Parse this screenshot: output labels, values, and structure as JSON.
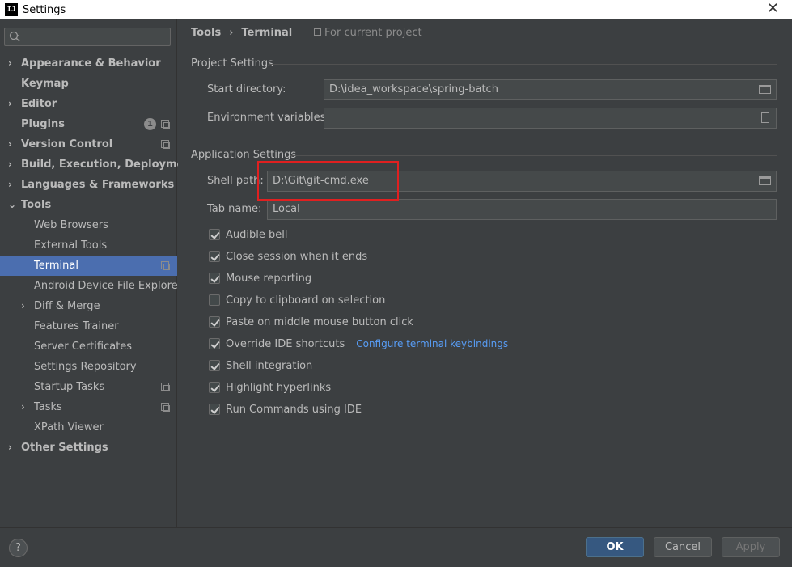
{
  "window": {
    "title": "Settings",
    "app_icon": "IJ"
  },
  "sidebar": {
    "search": {
      "value": "",
      "placeholder": ""
    },
    "items": [
      {
        "label": "Appearance & Behavior",
        "bold": true,
        "arrow": "›",
        "level": 0
      },
      {
        "label": "Keymap",
        "bold": true,
        "arrow": "",
        "level": 0
      },
      {
        "label": "Editor",
        "bold": true,
        "arrow": "›",
        "level": 0
      },
      {
        "label": "Plugins",
        "bold": true,
        "arrow": "",
        "level": 0,
        "badge": "1",
        "project_icon": true
      },
      {
        "label": "Version Control",
        "bold": true,
        "arrow": "›",
        "level": 0,
        "project_icon": true
      },
      {
        "label": "Build, Execution, Deployment",
        "bold": true,
        "arrow": "›",
        "level": 0
      },
      {
        "label": "Languages & Frameworks",
        "bold": true,
        "arrow": "›",
        "level": 0
      },
      {
        "label": "Tools",
        "bold": true,
        "arrow": "⌄",
        "level": 0
      },
      {
        "label": "Web Browsers",
        "level": 1
      },
      {
        "label": "External Tools",
        "level": 1
      },
      {
        "label": "Terminal",
        "level": 1,
        "selected": true,
        "project_icon": true
      },
      {
        "label": "Android Device File Explorer",
        "level": 1
      },
      {
        "label": "Diff & Merge",
        "level": 1,
        "arrow": "›"
      },
      {
        "label": "Features Trainer",
        "level": 1
      },
      {
        "label": "Server Certificates",
        "level": 1
      },
      {
        "label": "Settings Repository",
        "level": 1
      },
      {
        "label": "Startup Tasks",
        "level": 1,
        "project_icon": true
      },
      {
        "label": "Tasks",
        "level": 1,
        "arrow": "›",
        "project_icon": true
      },
      {
        "label": "XPath Viewer",
        "level": 1
      },
      {
        "label": "Other Settings",
        "bold": true,
        "arrow": "›",
        "level": 0
      }
    ]
  },
  "main": {
    "breadcrumb": [
      "Tools",
      "›",
      "Terminal"
    ],
    "for_project": "For current project",
    "project_settings": {
      "title": "Project Settings",
      "start_directory": {
        "label": "Start directory:",
        "value": "D:\\idea_workspace\\spring-batch"
      },
      "env_vars": {
        "label": "Environment variables:",
        "value": ""
      }
    },
    "app_settings": {
      "title": "Application Settings",
      "shell_path": {
        "label": "Shell path:",
        "value": "D:\\Git\\git-cmd.exe"
      },
      "tab_name": {
        "label": "Tab name:",
        "value": "Local"
      }
    },
    "checkboxes": [
      {
        "label": "Audible bell",
        "checked": true
      },
      {
        "label": "Close session when it ends",
        "checked": true
      },
      {
        "label": "Mouse reporting",
        "checked": true
      },
      {
        "label": "Copy to clipboard on selection",
        "checked": false
      },
      {
        "label": "Paste on middle mouse button click",
        "checked": true
      },
      {
        "label": "Override IDE shortcuts",
        "checked": true,
        "link": "Configure terminal keybindings"
      },
      {
        "label": "Shell integration",
        "checked": true
      },
      {
        "label": "Highlight hyperlinks",
        "checked": true
      },
      {
        "label": "Run Commands using IDE",
        "checked": true
      }
    ]
  },
  "footer": {
    "help": "?",
    "ok": "OK",
    "cancel": "Cancel",
    "apply": "Apply"
  },
  "colors": {
    "accent": "#4b6eaf",
    "ok_button": "#365880",
    "highlight": "#e02020",
    "link": "#589df6"
  }
}
